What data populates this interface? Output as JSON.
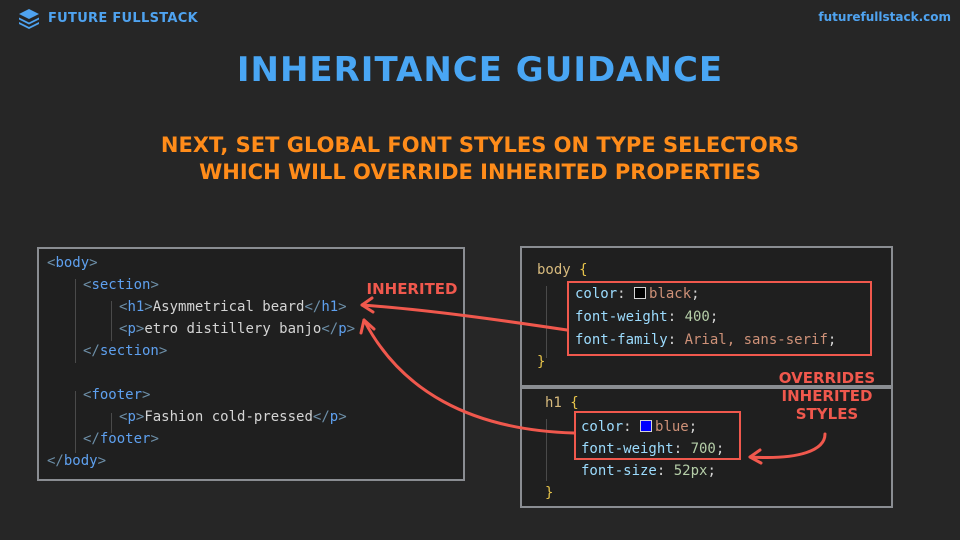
{
  "header": {
    "brand_name": "FUTURE FULLSTACK",
    "site_url": "futurefullstack.com"
  },
  "slide": {
    "title": "INHERITANCE GUIDANCE",
    "subtitle_line1": "NEXT, SET GLOBAL FONT STYLES ON TYPE SELECTORS",
    "subtitle_line2": "WHICH WILL OVERRIDE INHERITED PROPERTIES"
  },
  "html_code": {
    "body_tag": "body",
    "section_tag": "section",
    "h1_tag": "h1",
    "h1_text": "Asymmetrical beard",
    "p_tag": "p",
    "p1_text": "etro distillery banjo",
    "footer_tag": "footer",
    "p2_text": "Fashion cold-pressed"
  },
  "body_rule": {
    "selector": "body",
    "color_prop": "color",
    "color_value": "black",
    "color_hex": "#000000",
    "weight_prop": "font-weight",
    "weight_value": "400",
    "family_prop": "font-family",
    "family_value": "Arial, sans-serif"
  },
  "h1_rule": {
    "selector": "h1",
    "color_prop": "color",
    "color_value": "blue",
    "color_hex": "#0000ff",
    "weight_prop": "font-weight",
    "weight_value": "700",
    "size_prop": "font-size",
    "size_value": "52px"
  },
  "annotations": {
    "inherited": "INHERITED",
    "overrides_line1": "OVERRIDES",
    "overrides_line2": "INHERITED",
    "overrides_line3": "STYLES"
  },
  "colors": {
    "accent_blue": "#49a6f4",
    "accent_orange": "#ff8c1a",
    "annotation_red": "#f0584d"
  }
}
